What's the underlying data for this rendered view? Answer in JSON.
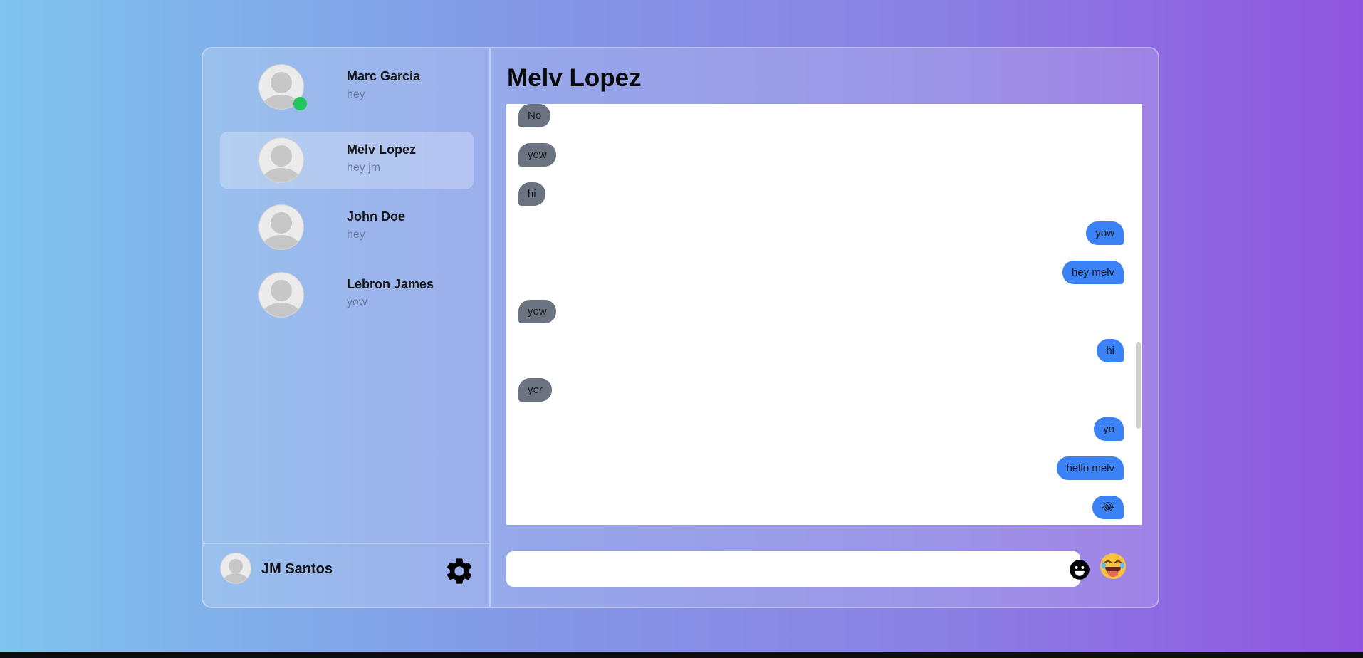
{
  "contacts": [
    {
      "name": "Marc Garcia",
      "preview": "hey",
      "online": true
    },
    {
      "name": "Melv Lopez",
      "preview": "hey jm",
      "active": true
    },
    {
      "name": "John Doe",
      "preview": "hey"
    },
    {
      "name": "Lebron James",
      "preview": "yow"
    }
  ],
  "user": {
    "name": "JM Santos"
  },
  "chat": {
    "title": "Melv Lopez"
  },
  "messages": [
    {
      "text": "No",
      "from": "them"
    },
    {
      "text": "yow",
      "from": "them"
    },
    {
      "text": "hi",
      "from": "them"
    },
    {
      "text": "yow",
      "from": "me"
    },
    {
      "text": "hey melv",
      "from": "me"
    },
    {
      "text": "yow",
      "from": "them"
    },
    {
      "text": "hi",
      "from": "me"
    },
    {
      "text": "yer",
      "from": "them"
    },
    {
      "text": "yo",
      "from": "me"
    },
    {
      "text": "hello melv",
      "from": "me"
    },
    {
      "text": "😂",
      "from": "me"
    }
  ],
  "composer": {
    "value": "",
    "placeholder": ""
  },
  "icons": {
    "settings": "gear-icon",
    "emoji_picker": "smiley-icon",
    "quick_emoji": "laughing-emoji-icon"
  },
  "colors": {
    "sent_bubble": "#3b82f6",
    "received_bubble": "#6b7280",
    "online": "#22c55e"
  }
}
